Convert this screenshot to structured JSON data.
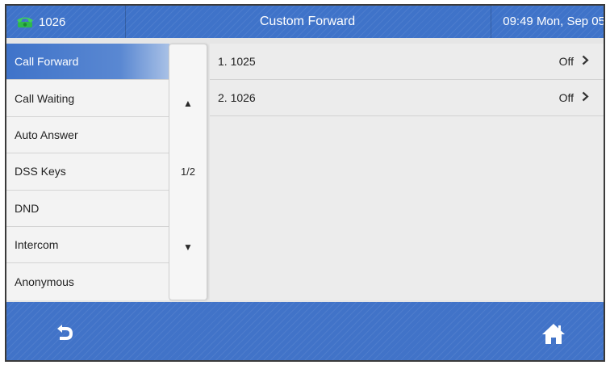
{
  "header": {
    "account": "1026",
    "title": "Custom Forward",
    "clock": "09:49 Mon, Sep 05",
    "phone_icon": "handset-icon"
  },
  "menu": {
    "items": [
      {
        "label": "Call Forward",
        "active": true
      },
      {
        "label": "Call Waiting"
      },
      {
        "label": "Auto Answer"
      },
      {
        "label": "DSS Keys"
      },
      {
        "label": "DND"
      },
      {
        "label": "Intercom"
      },
      {
        "label": "Anonymous"
      }
    ]
  },
  "pager": {
    "up_icon": "▲",
    "page": "1/2",
    "down_icon": "▼"
  },
  "accounts": [
    {
      "label": "1. 1025",
      "status": "Off",
      "chevron": "›"
    },
    {
      "label": "2. 1026",
      "status": "Off",
      "chevron": "›"
    }
  ],
  "footer": {
    "back_icon": "back-arrow-icon",
    "home_icon": "home-icon"
  },
  "colors": {
    "accent": "#3f73c9",
    "phone_green": "#2fb84a",
    "background": "#e6e6e6"
  }
}
